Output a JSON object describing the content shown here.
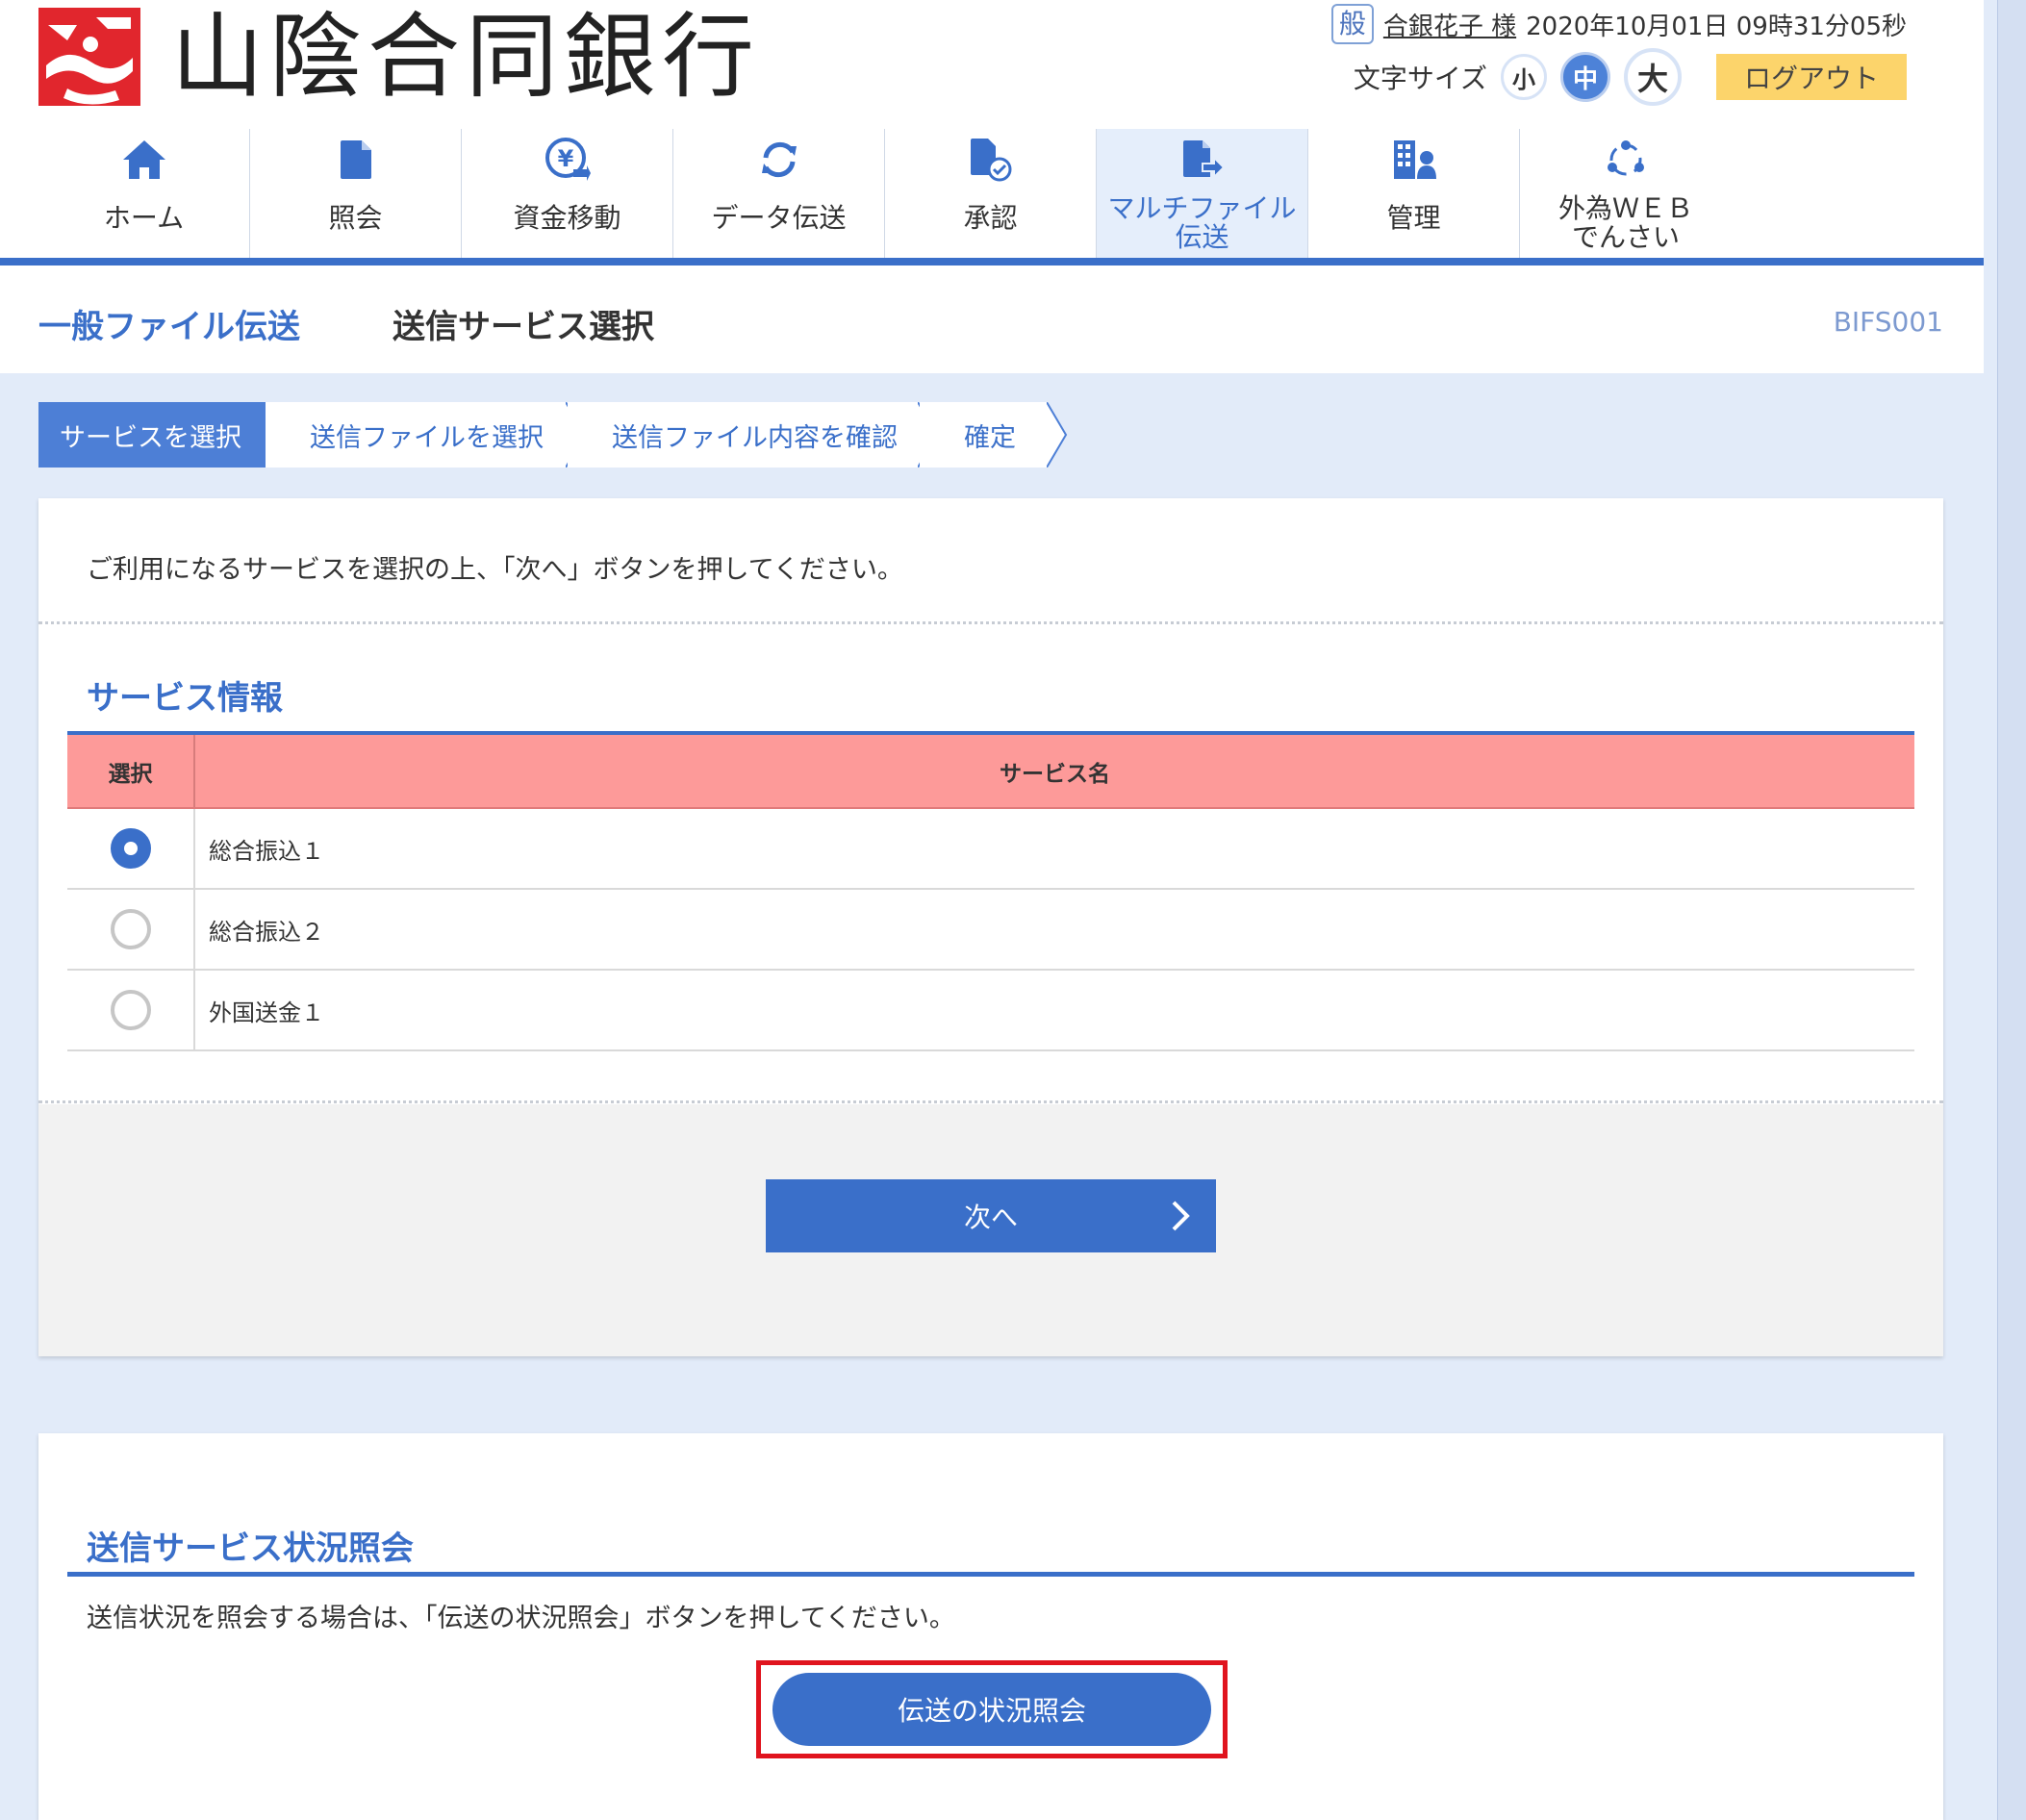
{
  "header": {
    "bank_name": "山陰合同銀行",
    "user_badge": "般",
    "user_name": "合銀花子 様",
    "datetime": "2020年10月01日 09時31分05秒",
    "font_size_label": "文字サイズ",
    "font_sizes": {
      "small": "小",
      "medium": "中",
      "large": "大"
    },
    "logout_label": "ログアウト"
  },
  "nav": {
    "items": [
      {
        "label": "ホーム",
        "icon": "home-icon"
      },
      {
        "label": "照会",
        "icon": "document-icon"
      },
      {
        "label": "資金移動",
        "icon": "yen-transfer-icon"
      },
      {
        "label": "データ伝送",
        "icon": "refresh-icon"
      },
      {
        "label": "承認",
        "icon": "approve-document-icon"
      },
      {
        "label": "マルチファイル\n伝送",
        "icon": "file-send-icon"
      },
      {
        "label": "管理",
        "icon": "management-icon"
      },
      {
        "label": "外為ＷＥＢ\nでんさい",
        "icon": "network-icon"
      }
    ],
    "active_index": 5
  },
  "page": {
    "title_main": "一般ファイル伝送",
    "title_sub": "送信サービス選択",
    "screen_id": "BIFS001"
  },
  "steps": [
    "サービスを選択",
    "送信ファイルを選択",
    "送信ファイル内容を確認",
    "確定"
  ],
  "service_card": {
    "instruction": "ご利用になるサービスを選択の上、「次へ」ボタンを押してください。",
    "section_title": "サービス情報",
    "columns": {
      "select": "選択",
      "service_name": "サービス名"
    },
    "rows": [
      {
        "name": "総合振込１",
        "selected": true
      },
      {
        "name": "総合振込２",
        "selected": false
      },
      {
        "name": "外国送金１",
        "selected": false
      }
    ],
    "next_label": "次へ"
  },
  "status_card": {
    "section_title": "送信サービス状況照会",
    "text": "送信状況を照会する場合は、「伝送の状況照会」ボタンを押してください。",
    "button_label": "伝送の状況照会"
  },
  "colors": {
    "accent": "#3a6fc9",
    "table_header": "#fd9a99",
    "logout": "#fcd46b",
    "highlight_frame": "#e0141e",
    "logo_red": "#e1262d"
  }
}
